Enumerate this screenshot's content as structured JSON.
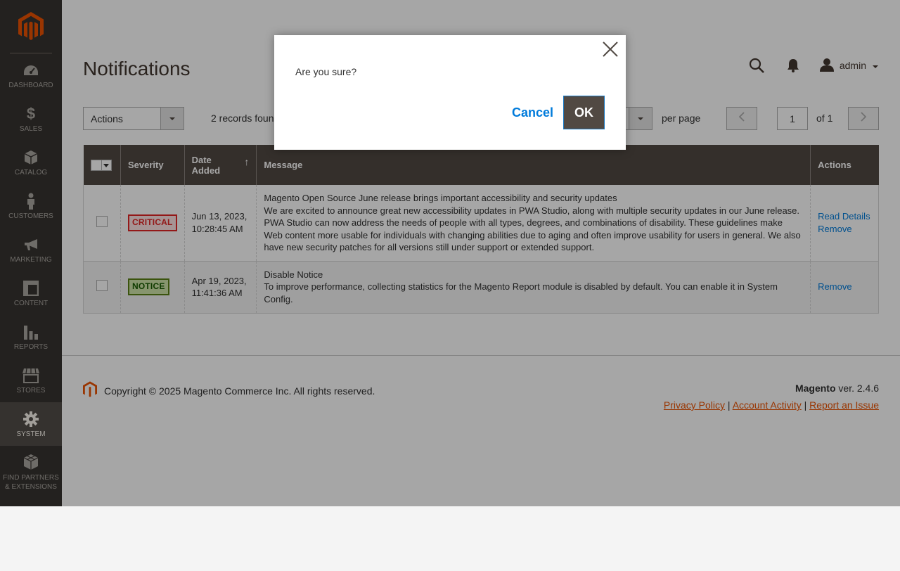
{
  "sidebar": {
    "items": [
      {
        "label": "DASHBOARD",
        "icon": "dashboard-icon"
      },
      {
        "label": "SALES",
        "icon": "dollar-icon"
      },
      {
        "label": "CATALOG",
        "icon": "box-icon"
      },
      {
        "label": "CUSTOMERS",
        "icon": "person-icon"
      },
      {
        "label": "MARKETING",
        "icon": "megaphone-icon"
      },
      {
        "label": "CONTENT",
        "icon": "layout-icon"
      },
      {
        "label": "REPORTS",
        "icon": "bar-chart-icon"
      },
      {
        "label": "STORES",
        "icon": "store-icon"
      },
      {
        "label": "SYSTEM",
        "icon": "gear-icon"
      },
      {
        "label_line1": "FIND PARTNERS",
        "label_line2": "& EXTENSIONS",
        "icon": "cubes-icon"
      }
    ],
    "active": "SYSTEM"
  },
  "page": {
    "title": "Notifications"
  },
  "header": {
    "user": "admin"
  },
  "toolbar": {
    "actions_label": "Actions",
    "records_found": "2 records found",
    "per_page_label": "per page",
    "current_page": "1",
    "of_pages": "of 1"
  },
  "grid": {
    "columns": {
      "severity": "Severity",
      "date_line1": "Date",
      "date_line2": "Added",
      "message": "Message",
      "actions": "Actions"
    },
    "sort_indicator": "↑",
    "rows": [
      {
        "severity": "CRITICAL",
        "date_line1": "Jun 13, 2023,",
        "date_line2": "10:28:45 AM",
        "title": "Magento Open Source June release brings important accessibility and security updates",
        "body": "We are excited to announce great new accessibility updates in PWA Studio, along with multiple security updates in our June release. PWA Studio can now address the needs of people with all types, degrees, and combinations of disability. These guidelines make Web content more usable for individuals with changing abilities due to aging and often improve usability for users in general. We also have new security patches for all versions still under support or extended support.",
        "action_read": "Read Details",
        "action_remove": "Remove"
      },
      {
        "severity": "NOTICE",
        "date_line1": "Apr 19, 2023,",
        "date_line2": "11:41:36 AM",
        "title": "Disable Notice",
        "body": "To improve performance, collecting statistics for the Magento Report module is disabled by default. You can enable it in System Config.",
        "action_remove": "Remove"
      }
    ]
  },
  "footer": {
    "copyright": "Copyright © 2025 Magento Commerce Inc. All rights reserved.",
    "brand": "Magento",
    "version": " ver. 2.4.6",
    "links": {
      "privacy": "Privacy Policy",
      "activity": " Account Activity",
      "report": "Report an Issue",
      "separator": "|"
    }
  },
  "modal": {
    "text": "Are you sure?",
    "cancel": "Cancel",
    "ok": "OK"
  },
  "colors": {
    "sidebar_bg": "#373330",
    "accent_orange": "#eb5202",
    "link_blue": "#007bdb",
    "header_row": "#514943"
  }
}
